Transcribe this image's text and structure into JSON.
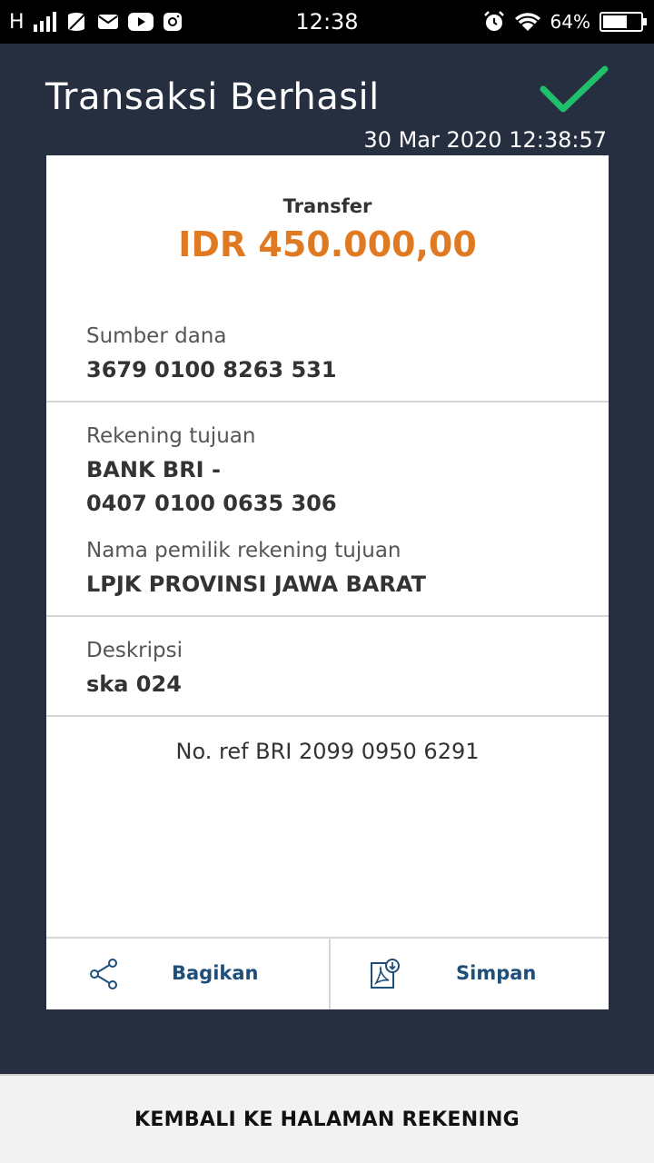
{
  "status_bar": {
    "network": "H",
    "time": "12:38",
    "battery_percent": "64%",
    "battery_level": 0.64,
    "icons": [
      "signal-icon",
      "data-icon",
      "mail-icon",
      "youtube-icon",
      "instagram-icon",
      "alarm-icon",
      "wifi-icon",
      "battery-icon"
    ]
  },
  "header": {
    "title": "Transaksi Berhasil",
    "datetime": "30 Mar 2020 12:38:57",
    "success_color": "#1fbf6b"
  },
  "receipt": {
    "type": "Transfer",
    "amount": "IDR 450.000,00",
    "amount_color": "#e07a22",
    "source_label": "Sumber dana",
    "source_value": "3679 0100 8263 531",
    "dest_label": "Rekening tujuan",
    "dest_bank": "BANK BRI -",
    "dest_account": "0407 0100 0635 306",
    "owner_label": "Nama pemilik rekening tujuan",
    "owner_value": "LPJK PROVINSI JAWA BARAT",
    "desc_label": "Deskripsi",
    "desc_value": "ska 024",
    "reference": "No. ref BRI 2099 0950 6291"
  },
  "actions": {
    "share_label": "Bagikan",
    "save_label": "Simpan",
    "label_color": "#1e4e7a"
  },
  "footer": {
    "back_label": "KEMBALI KE HALAMAN REKENING"
  }
}
